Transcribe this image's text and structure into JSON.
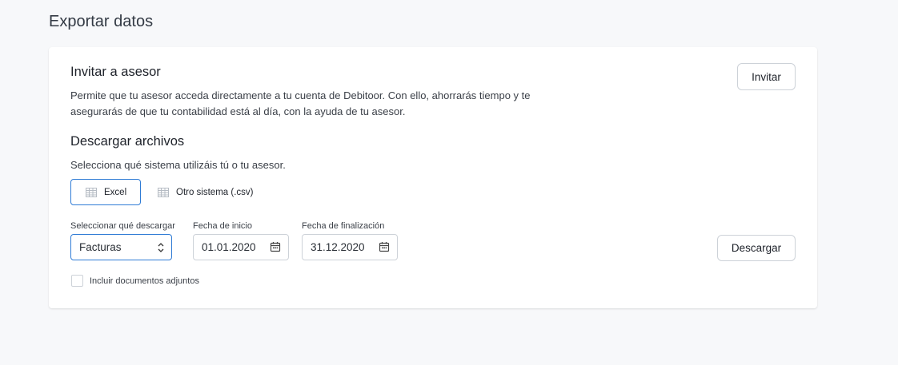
{
  "page": {
    "title": "Exportar datos"
  },
  "invite": {
    "title": "Invitar a asesor",
    "description_line1": "Permite que tu asesor acceda directamente a tu cuenta de Debitoor. Con ello, ahorrarás tiempo y te",
    "description_line2": "asegurarás de que tu contabilidad está al día, con la ayuda de tu asesor.",
    "button_label": "Invitar"
  },
  "download": {
    "title": "Descargar archivos",
    "subtitle": "Selecciona qué sistema utilizáis tú o tu asesor.",
    "systems": [
      {
        "label": "Excel",
        "icon": "spreadsheet-icon",
        "selected": true
      },
      {
        "label": "Otro sistema (.csv)",
        "icon": "spreadsheet-icon",
        "selected": false
      }
    ],
    "select_label": "Seleccionar qué descargar",
    "select_value": "Facturas",
    "start_label": "Fecha de inicio",
    "start_value": "01.01.2020",
    "end_label": "Fecha de finalización",
    "end_value": "31.12.2020",
    "button_label": "Descargar",
    "attachments_label": "Incluir documentos adjuntos",
    "attachments_checked": false
  },
  "colors": {
    "accent": "#2f7bd5",
    "border": "#cdd2d8",
    "background": "#f7f8fa"
  }
}
